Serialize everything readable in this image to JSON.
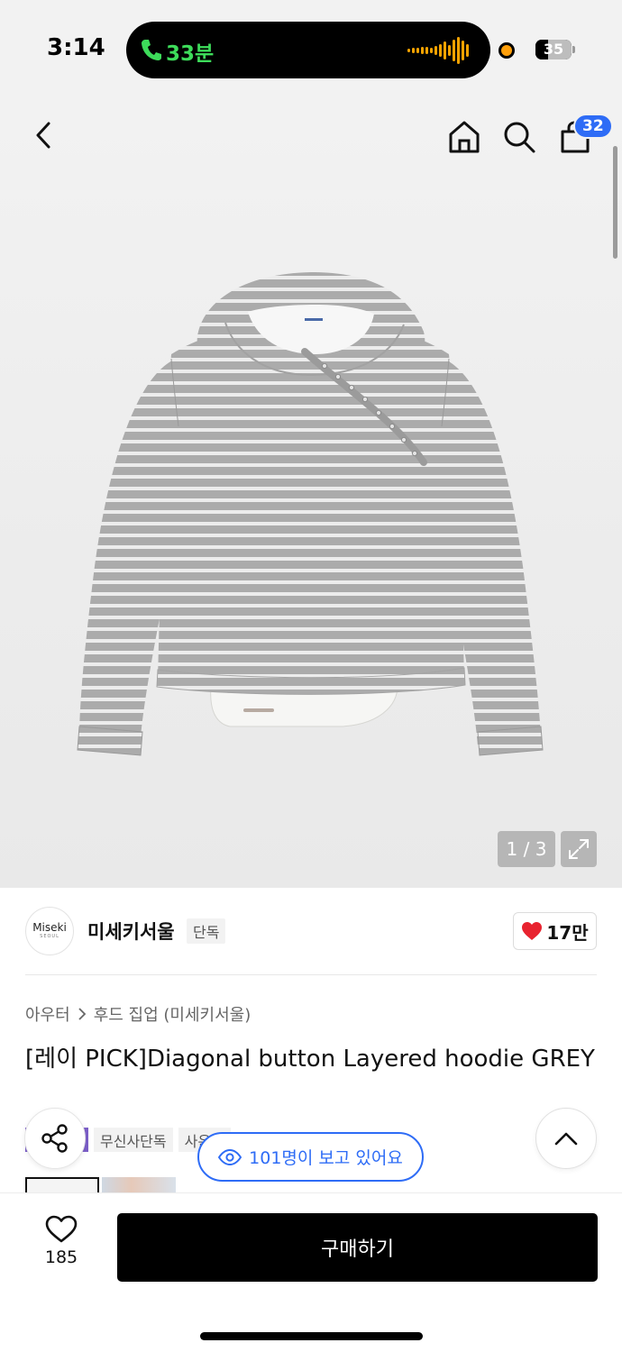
{
  "status_bar": {
    "time": "3:14",
    "call_duration": "33분",
    "battery_level": "35",
    "battery_percent": 35
  },
  "header": {
    "cart_count": "32"
  },
  "gallery": {
    "counter": "1 / 3"
  },
  "brand": {
    "logo_text": "Miseki",
    "logo_sub": "SEOUL",
    "name": "미세키서울",
    "tag": "단독",
    "like_count": "17만"
  },
  "product": {
    "breadcrumb": [
      "아우터",
      "후드 집업 (미세키서울)"
    ],
    "title": "[레이 PICK]Diagonal button Layered hoodie GREY",
    "tags": [
      "무신사단독",
      "사은품"
    ]
  },
  "viewers": {
    "label": "101명이 보고 있어요"
  },
  "bottom_bar": {
    "wish_count": "185",
    "buy_label": "구매하기"
  },
  "colors": {
    "accent_blue": "#2e6cf6",
    "heart_red": "#e8232f",
    "call_green": "#3ddc5a",
    "buy_button": "#000000"
  },
  "icons": [
    "phone-icon",
    "waveform-icon",
    "back-icon",
    "home-icon",
    "search-icon",
    "cart-icon",
    "expand-icon",
    "heart-icon",
    "share-icon",
    "eye-icon",
    "chevron-up-icon",
    "heart-outline-icon",
    "chevron-right-icon"
  ]
}
